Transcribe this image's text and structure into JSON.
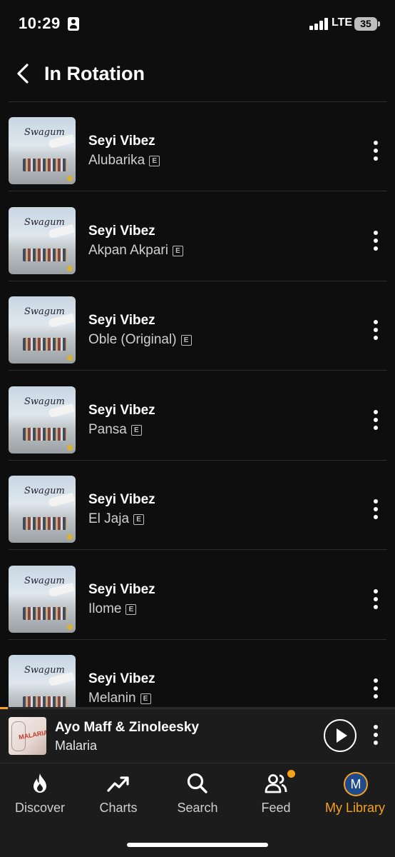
{
  "status_bar": {
    "time": "10:29",
    "network": "LTE",
    "battery": "35"
  },
  "header": {
    "title": "In Rotation"
  },
  "tracks": [
    {
      "artist": "Seyi Vibez",
      "title": "Alubarika",
      "explicit": "E",
      "art_text": "Swagum"
    },
    {
      "artist": "Seyi Vibez",
      "title": "Akpan Akpari",
      "explicit": "E",
      "art_text": "Swagum"
    },
    {
      "artist": "Seyi Vibez",
      "title": "Oble (Original)",
      "explicit": "E",
      "art_text": "Swagum"
    },
    {
      "artist": "Seyi Vibez",
      "title": "Pansa",
      "explicit": "E",
      "art_text": "Swagum"
    },
    {
      "artist": "Seyi Vibez",
      "title": "El Jaja",
      "explicit": "E",
      "art_text": "Swagum"
    },
    {
      "artist": "Seyi Vibez",
      "title": "Ilome",
      "explicit": "E",
      "art_text": "Swagum"
    },
    {
      "artist": "Seyi Vibez",
      "title": "Melanin",
      "explicit": "E",
      "art_text": "Swagum"
    }
  ],
  "now_playing": {
    "artist": "Ayo Maff & Zinoleesky",
    "title": "Malaria",
    "art_text": "MALARIA",
    "progress": 0.02
  },
  "tabs": [
    {
      "label": "Discover",
      "icon": "fire-icon"
    },
    {
      "label": "Charts",
      "icon": "trending-up-icon"
    },
    {
      "label": "Search",
      "icon": "search-icon"
    },
    {
      "label": "Feed",
      "icon": "users-icon"
    },
    {
      "label": "My Library",
      "icon": "avatar",
      "avatar_letter": "M",
      "active": true
    }
  ],
  "colors": {
    "accent": "#f7a21b",
    "background": "#0e0e0e",
    "surface": "#1c1c1c",
    "avatar": "#1f4a8c"
  }
}
